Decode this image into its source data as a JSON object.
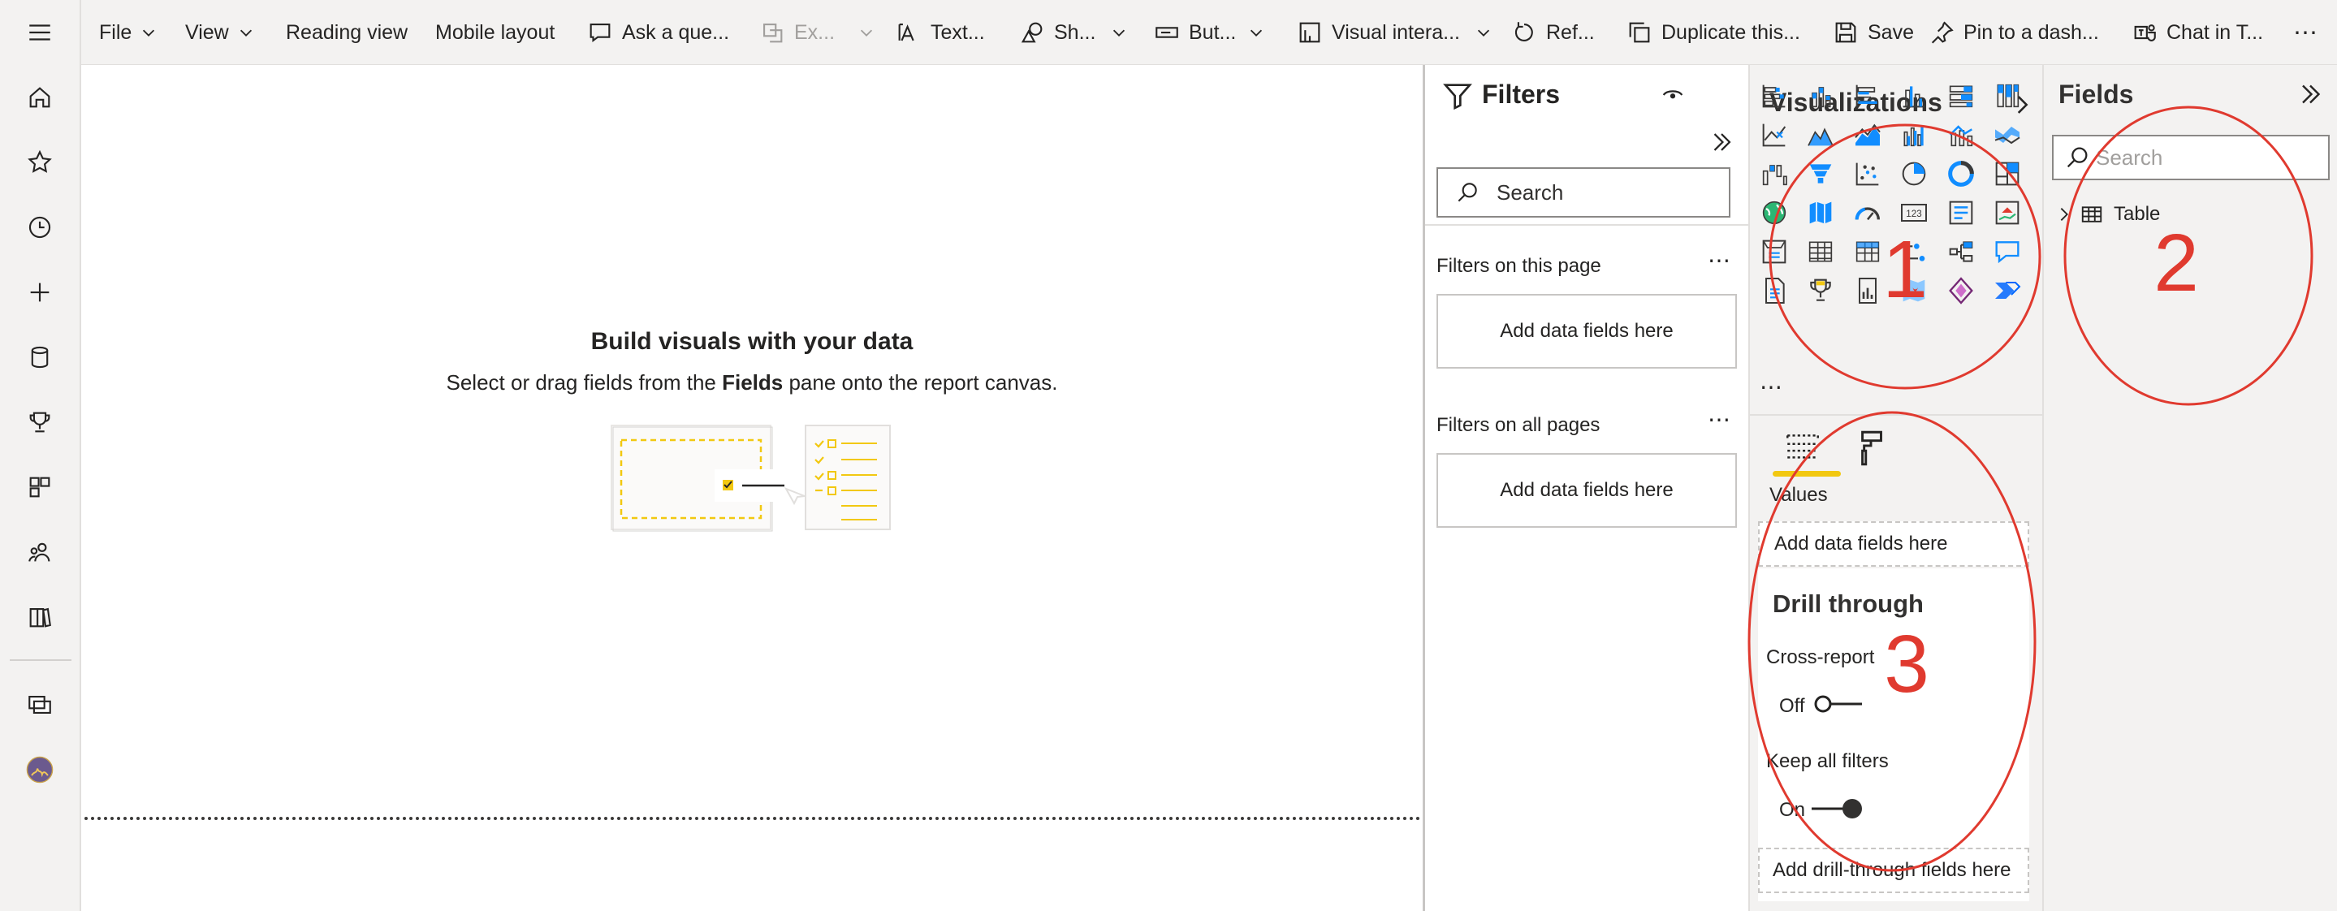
{
  "rail": {
    "icons": [
      "hamburger-icon",
      "home-icon",
      "star-icon",
      "clock-icon",
      "plus-icon",
      "database-icon",
      "trophy-icon",
      "apps-icon",
      "people-icon",
      "book-icon",
      "workspaces-icon",
      "avatar"
    ]
  },
  "toolbar": {
    "file": "File",
    "view": "View",
    "reading_view": "Reading view",
    "mobile_layout": "Mobile layout",
    "ask": "Ask a que...",
    "export": "Ex...",
    "text": "Text...",
    "shapes": "Sh...",
    "buttons": "But...",
    "visual_interactions": "Visual intera...",
    "refresh": "Ref...",
    "duplicate": "Duplicate this...",
    "save": "Save",
    "pin": "Pin to a dash...",
    "chat": "Chat in T...",
    "more": "⋯"
  },
  "canvas": {
    "title": "Build visuals with your data",
    "subtitle_before": "Select or drag fields from the ",
    "subtitle_bold": "Fields",
    "subtitle_after": " pane onto the report canvas."
  },
  "filters": {
    "title": "Filters",
    "search_placeholder": "Search",
    "on_this_page": "Filters on this page",
    "on_all_pages": "Filters on all pages",
    "add_fields": "Add data fields here",
    "more": "⋯"
  },
  "visualizations": {
    "title": "Visualizations",
    "more": "⋯",
    "values_label": "Values",
    "values_well": "Add data fields here",
    "drill_title": "Drill through",
    "cross_report": "Cross-report",
    "cross_state": "Off",
    "keep_filters": "Keep all filters",
    "keep_state": "On",
    "drill_well": "Add drill-through fields here"
  },
  "fields": {
    "title": "Fields",
    "search_placeholder": "Search",
    "table": "Table"
  },
  "annotations": {
    "labels": [
      "1",
      "2",
      "3"
    ],
    "color": "#e03a2f"
  },
  "colors": {
    "accent_yellow": "#f2c811",
    "viz_blue": "#118dff",
    "viz_dark": "#3b3a39"
  }
}
